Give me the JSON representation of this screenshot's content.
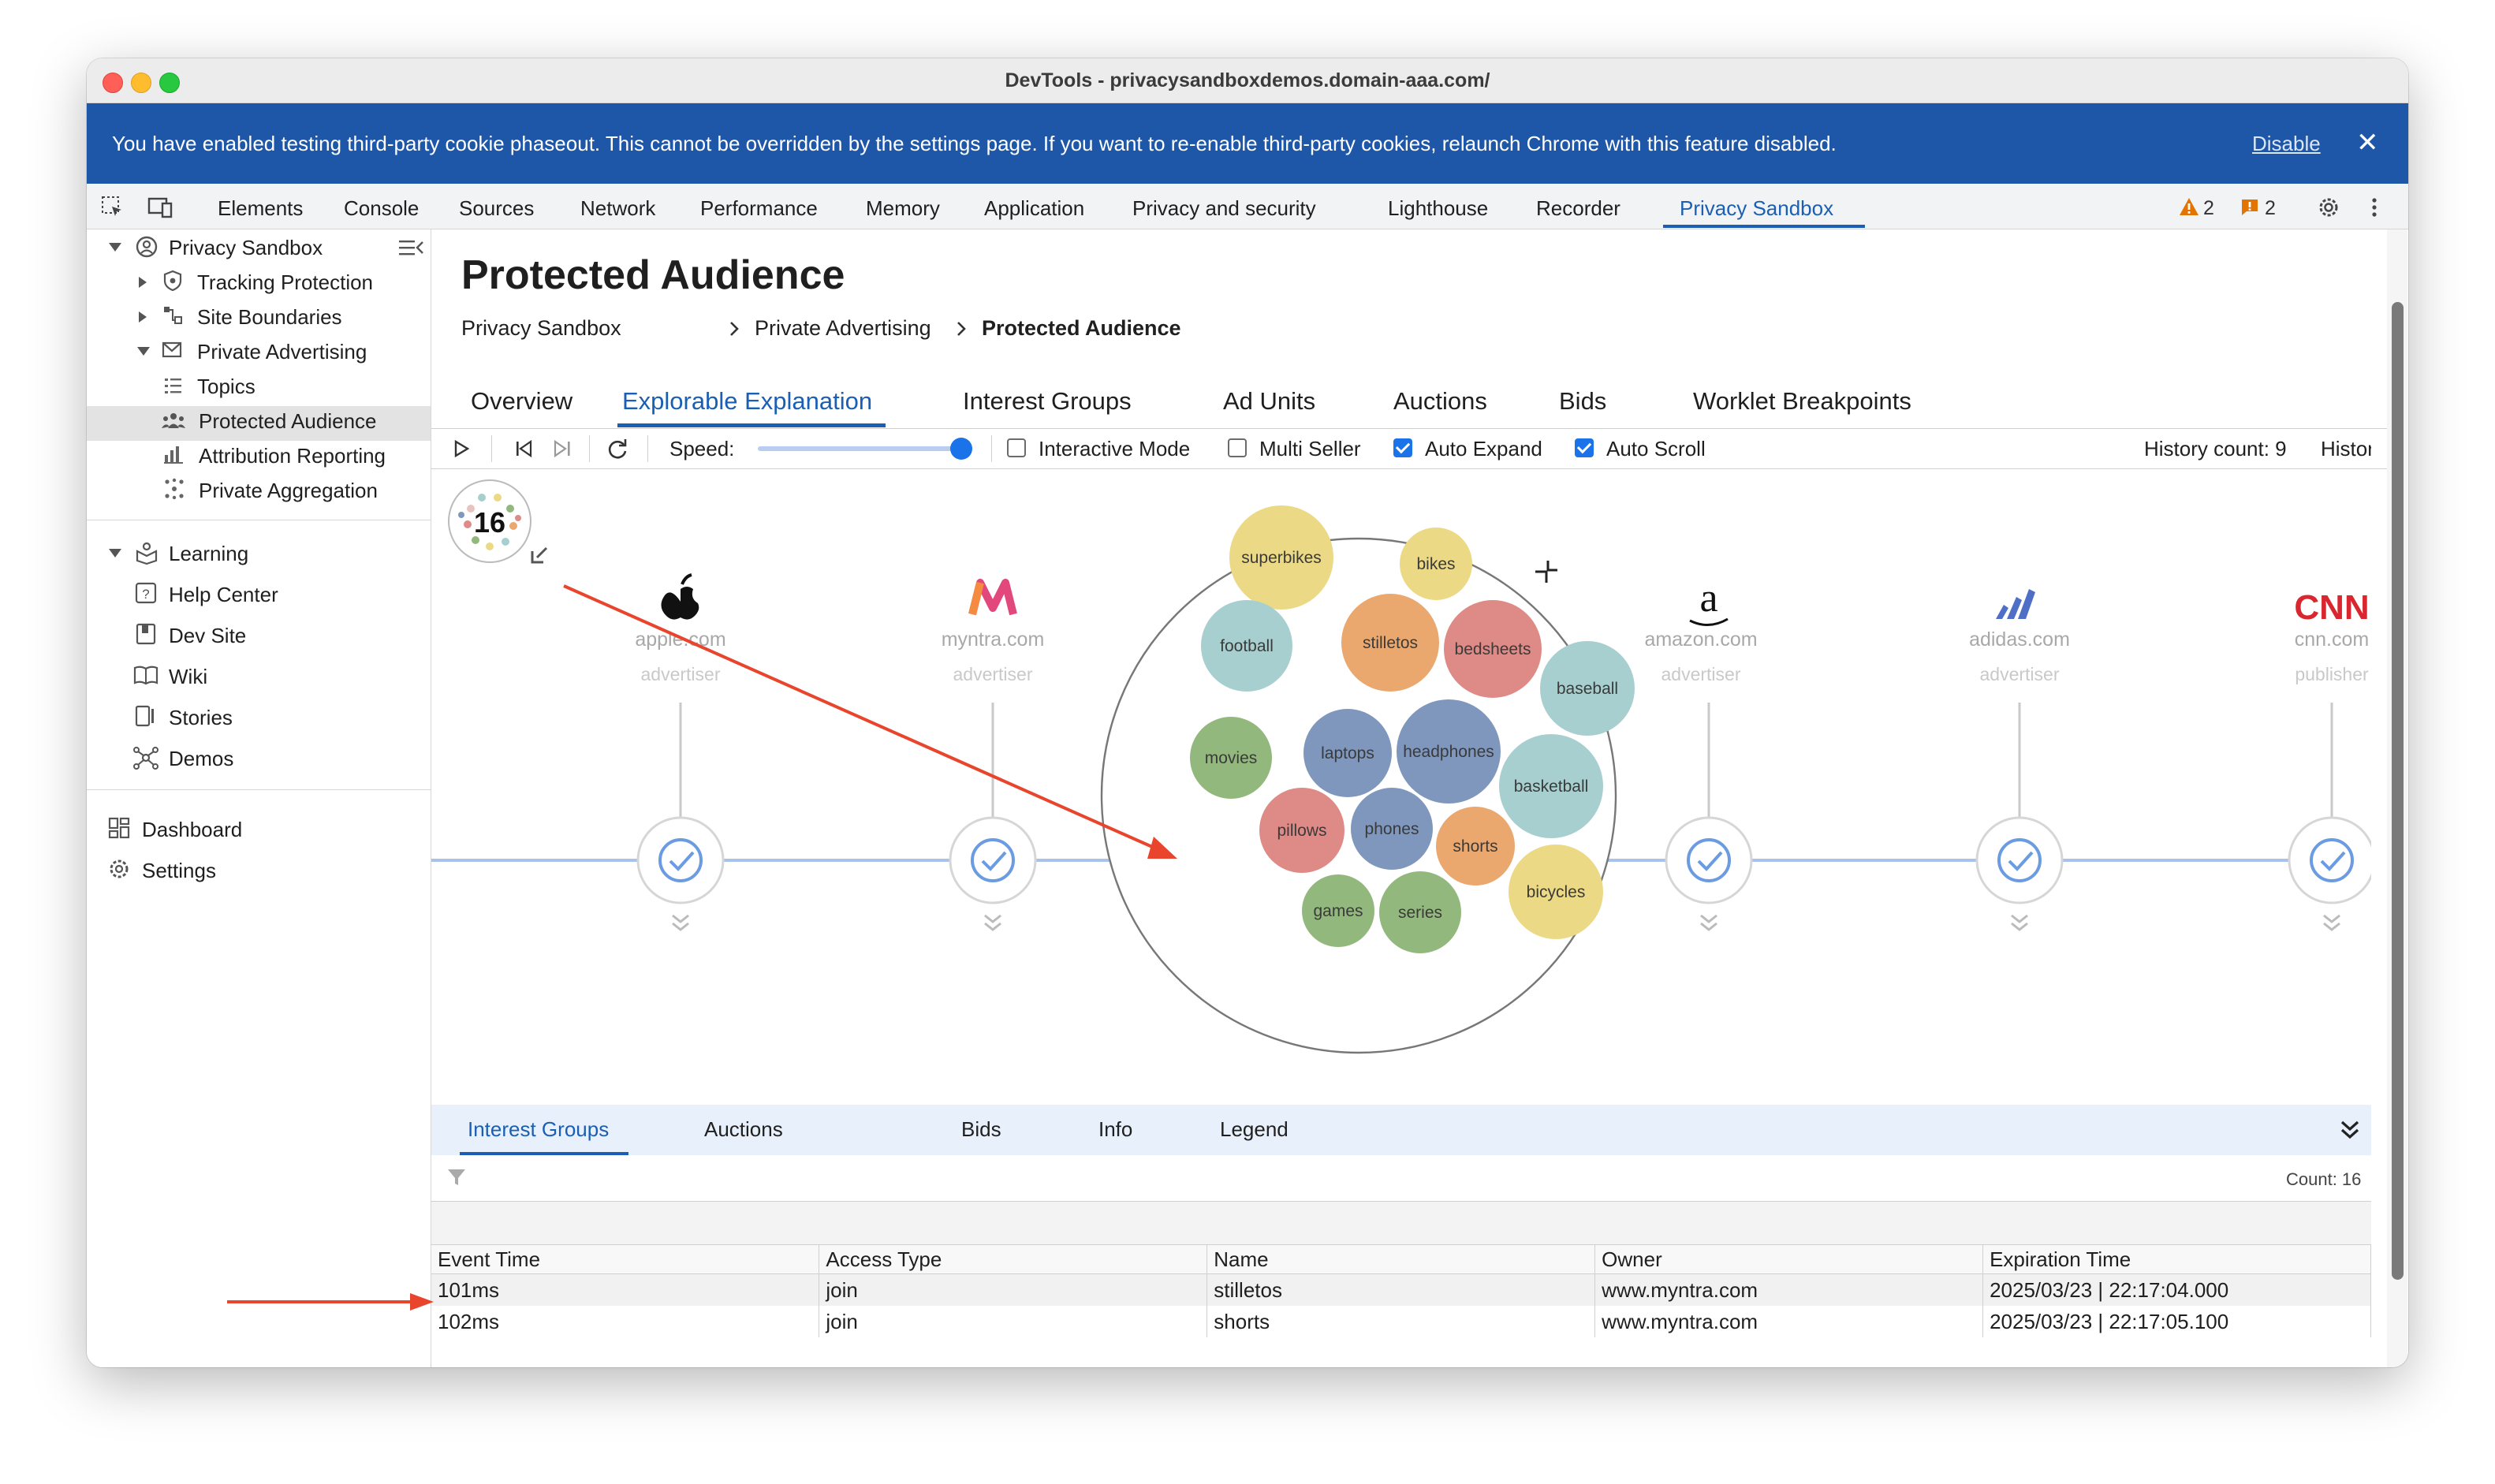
{
  "window": {
    "title": "DevTools - privacysandboxdemos.domain-aaa.com/"
  },
  "banner": {
    "message": "You have enabled testing third-party cookie phaseout. This cannot be overridden by the settings page. If you want to re-enable third-party cookies, relaunch Chrome with this feature disabled.",
    "action": "Disable"
  },
  "devtools_tabs": [
    "Elements",
    "Console",
    "Sources",
    "Network",
    "Performance",
    "Memory",
    "Application",
    "Privacy and security",
    "Lighthouse",
    "Recorder",
    "Privacy Sandbox"
  ],
  "active_devtools_tab": "Privacy Sandbox",
  "issue_counts": {
    "warnings": "2",
    "errors": "2"
  },
  "sidebar": {
    "root": "Privacy Sandbox",
    "items": [
      "Tracking Protection",
      "Site Boundaries",
      "Private Advertising",
      "Topics",
      "Protected Audience",
      "Attribution Reporting",
      "Private Aggregation"
    ],
    "selected": "Protected Audience",
    "learning": {
      "title": "Learning",
      "items": [
        "Help Center",
        "Dev Site",
        "Wiki",
        "Stories",
        "Demos"
      ]
    },
    "bottom": [
      "Dashboard",
      "Settings"
    ]
  },
  "page": {
    "title": "Protected Audience",
    "breadcrumb": [
      "Privacy Sandbox",
      "Private Advertising",
      "Protected Audience"
    ],
    "tabs": [
      "Overview",
      "Explorable Explanation",
      "Interest Groups",
      "Ad Units",
      "Auctions",
      "Bids",
      "Worklet Breakpoints"
    ],
    "active_tab": "Explorable Explanation"
  },
  "toolbar": {
    "speed_label": "Speed:",
    "speed_level": 1.0,
    "checkboxes": [
      {
        "label": "Interactive Mode",
        "checked": false
      },
      {
        "label": "Multi Seller",
        "checked": false
      },
      {
        "label": "Auto Expand",
        "checked": true
      },
      {
        "label": "Auto Scroll",
        "checked": true
      }
    ],
    "history_label": "History count: 9"
  },
  "explanation": {
    "counter": "16",
    "sites": [
      {
        "name": "apple.com",
        "role": "advertiser",
        "logo": "apple-logo"
      },
      {
        "name": "myntra.com",
        "role": "advertiser",
        "logo": "myntra-logo"
      },
      {
        "name": "amazon.com",
        "role": "advertiser",
        "logo": "amazon-logo"
      },
      {
        "name": "adidas.com",
        "role": "advertiser",
        "logo": "adidas-logo"
      },
      {
        "name": "cnn.com",
        "role": "publisher",
        "logo": "CNN"
      }
    ],
    "interest_bubbles": [
      "superbikes",
      "bikes",
      "football",
      "stilletos",
      "bedsheets",
      "baseball",
      "movies",
      "laptops",
      "headphones",
      "basketball",
      "pillows",
      "phones",
      "shorts",
      "bicycles",
      "games",
      "series"
    ],
    "bubble_colors": {
      "yellow": "#ecd985",
      "teal": "#a8cfcf",
      "orange": "#eaa86f",
      "red": "#de8a86",
      "green": "#93b87d",
      "blue": "#7f97bd"
    }
  },
  "bottom_panel": {
    "tabs": [
      "Interest Groups",
      "Auctions",
      "Bids",
      "Info",
      "Legend"
    ],
    "active_tab": "Interest Groups",
    "count_label": "Count: 16",
    "columns": [
      "Event Time",
      "Access Type",
      "Name",
      "Owner",
      "Expiration Time"
    ],
    "rows": [
      [
        "101ms",
        "join",
        "stilletos",
        "www.myntra.com",
        "2025/03/23 | 22:17:04.000"
      ],
      [
        "102ms",
        "join",
        "shorts",
        "www.myntra.com",
        "2025/03/23 | 22:17:05.100"
      ]
    ]
  },
  "annotation_color": "#e8452c"
}
